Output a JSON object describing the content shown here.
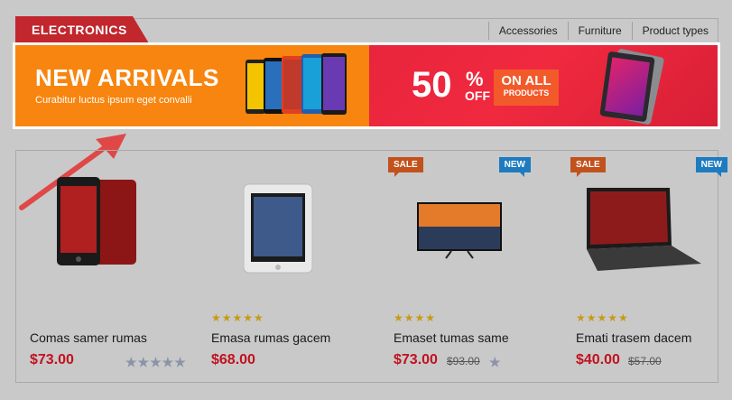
{
  "category": {
    "title": "ELECTRONICS"
  },
  "tabs": [
    {
      "label": "Accessories"
    },
    {
      "label": "Furniture"
    },
    {
      "label": "Product types"
    }
  ],
  "banner": {
    "headline": "NEW ARRIVALS",
    "subline": "Curabitur luctus ipsum eget convalli",
    "percent": "50",
    "percent_sign": "%",
    "off_label": "OFF",
    "on_all_line1": "ON ALL",
    "on_all_line2": "PRODUCTS",
    "left_color": "#f7850f",
    "right_color": "#e8253c"
  },
  "products": [
    {
      "name": "Comas samer rumas",
      "price": "$73.00",
      "old_price": "",
      "stars_filled": 0,
      "stars_total": 5,
      "badges": []
    },
    {
      "name": "Emasa rumas gacem",
      "price": "$68.00",
      "old_price": "",
      "stars_filled": 5,
      "stars_total": 5,
      "badges": []
    },
    {
      "name": "Emaset tumas same",
      "price": "$73.00",
      "old_price": "$93.00",
      "stars_filled": 4,
      "stars_total": 5,
      "badges": [
        "SALE",
        "NEW"
      ]
    },
    {
      "name": "Emati trasem dacem",
      "price": "$40.00",
      "old_price": "$57.00",
      "stars_filled": 5,
      "stars_total": 5,
      "badges": [
        "SALE",
        "NEW"
      ]
    }
  ],
  "colors": {
    "accent": "#c1272d",
    "price": "#c1121f",
    "sale_badge": "#c2521c",
    "new_badge": "#1e7bbf",
    "star": "#c89a14"
  }
}
